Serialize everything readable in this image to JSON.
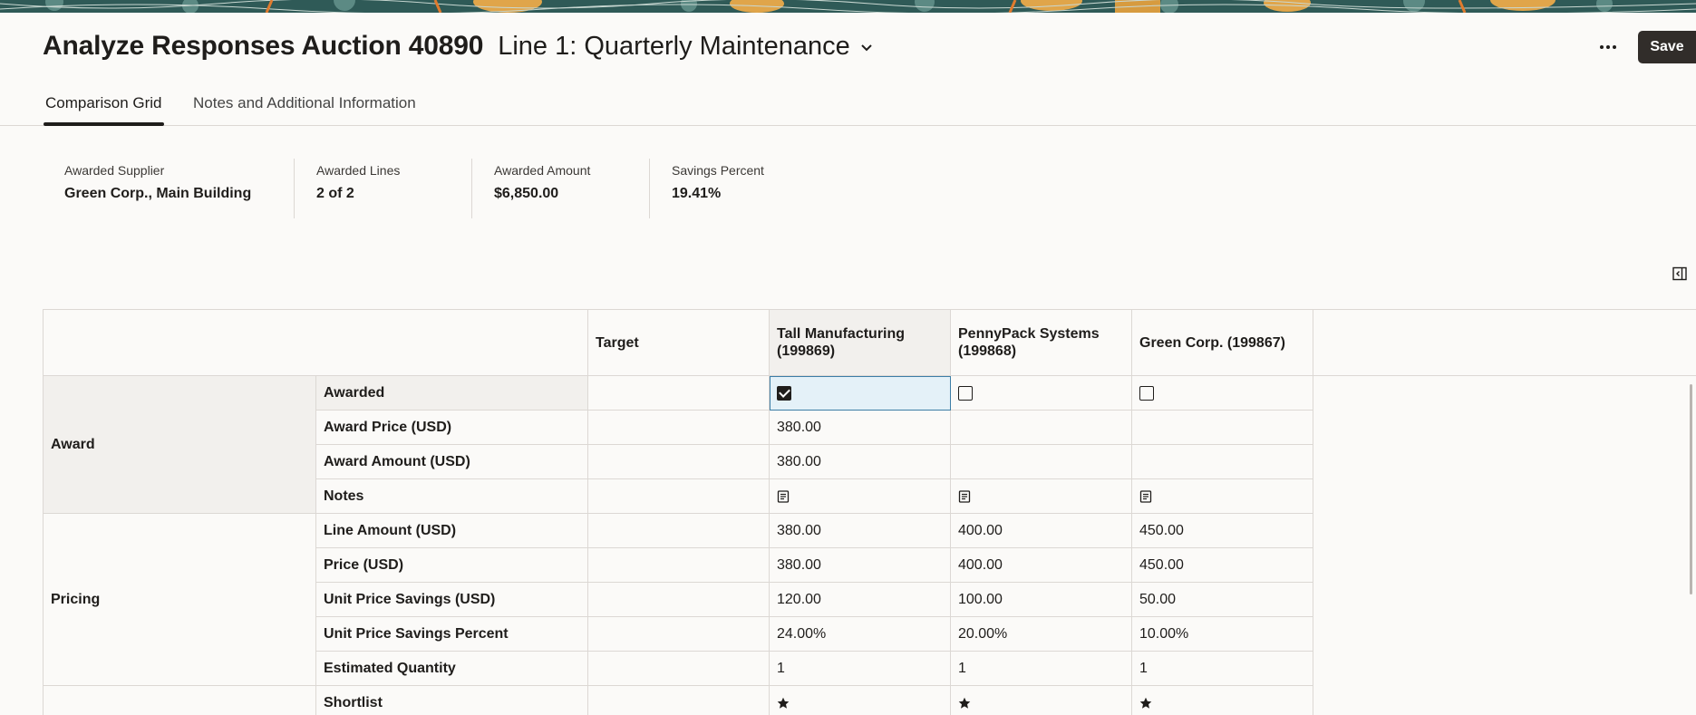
{
  "header": {
    "title": "Analyze Responses Auction 40890",
    "line_selector": "Line 1: Quarterly Maintenance",
    "save_label": "Save",
    "more_icon": "more-horizontal-icon"
  },
  "tabs": [
    {
      "label": "Comparison Grid",
      "active": true
    },
    {
      "label": "Notes and Additional Information",
      "active": false
    }
  ],
  "summary": [
    {
      "label": "Awarded Supplier",
      "value": "Green Corp., Main Building"
    },
    {
      "label": "Awarded Lines",
      "value": "2 of 2"
    },
    {
      "label": "Awarded Amount",
      "value": "$6,850.00"
    },
    {
      "label": "Savings Percent",
      "value": "19.41%"
    }
  ],
  "grid": {
    "columns": [
      "Target",
      "Tall Manufacturing (199869)",
      "PennyPack Systems (199868)",
      "Green Corp. (199867)"
    ],
    "groups": {
      "award": "Award",
      "pricing": "Pricing"
    },
    "rows": [
      {
        "label": "Awarded",
        "target": "",
        "c1": "checked",
        "c2": "unchecked",
        "c3": "unchecked"
      },
      {
        "label": "Award Price (USD)",
        "target": "",
        "c1": "380.00",
        "c2": "",
        "c3": ""
      },
      {
        "label": "Award Amount (USD)",
        "target": "",
        "c1": "380.00",
        "c2": "",
        "c3": ""
      },
      {
        "label": "Notes",
        "target": "",
        "c1": "notes-icon",
        "c2": "notes-icon",
        "c3": "notes-icon"
      },
      {
        "label": "Line Amount (USD)",
        "target": "",
        "c1": "380.00",
        "c2": "400.00",
        "c3": "450.00"
      },
      {
        "label": "Price (USD)",
        "target": "",
        "c1": "380.00",
        "c2": "400.00",
        "c3": "450.00"
      },
      {
        "label": "Unit Price Savings (USD)",
        "target": "",
        "c1": "120.00",
        "c2": "100.00",
        "c3": "50.00"
      },
      {
        "label": "Unit Price Savings Percent",
        "target": "",
        "c1": "24.00%",
        "c2": "20.00%",
        "c3": "10.00%"
      },
      {
        "label": "Estimated Quantity",
        "target": "",
        "c1": "1",
        "c2": "1",
        "c3": "1"
      },
      {
        "label": "Shortlist",
        "target": "",
        "c1": "star-icon",
        "c2": "star-icon",
        "c3": "star-icon"
      }
    ]
  }
}
